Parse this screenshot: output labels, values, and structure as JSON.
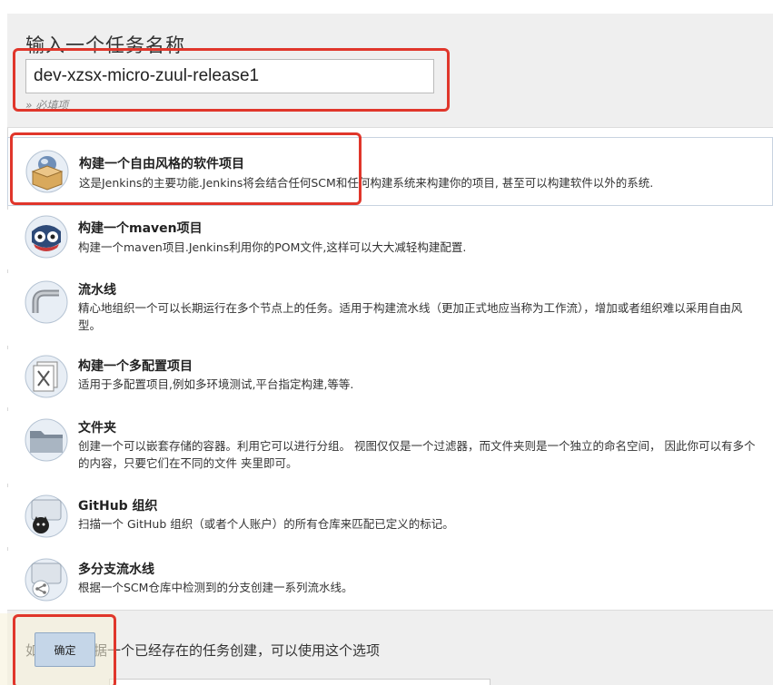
{
  "name_section": {
    "title": "输入一个任务名称",
    "input_value": "dev-xzsx-micro-zuul-release1",
    "required_note": "» 必填项"
  },
  "item_types": [
    {
      "title": "构建一个自由风格的软件项目",
      "desc": "这是Jenkins的主要功能.Jenkins将会结合任何SCM和任何构建系统来构建你的项目, 甚至可以构建软件以外的系统.",
      "icon": "package-icon",
      "selected": true
    },
    {
      "title": "构建一个maven项目",
      "desc": "构建一个maven项目.Jenkins利用你的POM文件,这样可以大大减轻构建配置.",
      "icon": "maven-owl-icon"
    },
    {
      "title": "流水线",
      "desc": "精心地组织一个可以长期运行在多个节点上的任务。适用于构建流水线（更加正式地应当称为工作流），增加或者组织难以采用自由风",
      "desc2": "型。",
      "icon": "pipeline-icon"
    },
    {
      "title": "构建一个多配置项目",
      "desc": "适用于多配置项目,例如多环境测试,平台指定构建,等等.",
      "icon": "multi-config-icon"
    },
    {
      "title": "文件夹",
      "desc": "创建一个可以嵌套存储的容器。利用它可以进行分组。 视图仅仅是一个过滤器，而文件夹则是一个独立的命名空间， 因此你可以有多个",
      "desc2": "的内容，只要它们在不同的文件 夹里即可。",
      "icon": "folder-icon"
    },
    {
      "title": "GitHub 组织",
      "desc": "扫描一个 GitHub 组织（或者个人账户）的所有仓库来匹配已定义的标记。",
      "icon": "github-org-icon"
    },
    {
      "title": "多分支流水线",
      "desc": "根据一个SCM仓库中检测到的分支创建一系列流水线。",
      "icon": "multibranch-icon"
    }
  ],
  "copy_section": {
    "text": "如果你想根据一个已经存在的任务创建，可以使用这个选项"
  },
  "ok_button": {
    "label": "确定"
  },
  "colors": {
    "highlight": "#e0362b",
    "section_bg": "#efefef",
    "button_bg": "#c5d6e8"
  }
}
